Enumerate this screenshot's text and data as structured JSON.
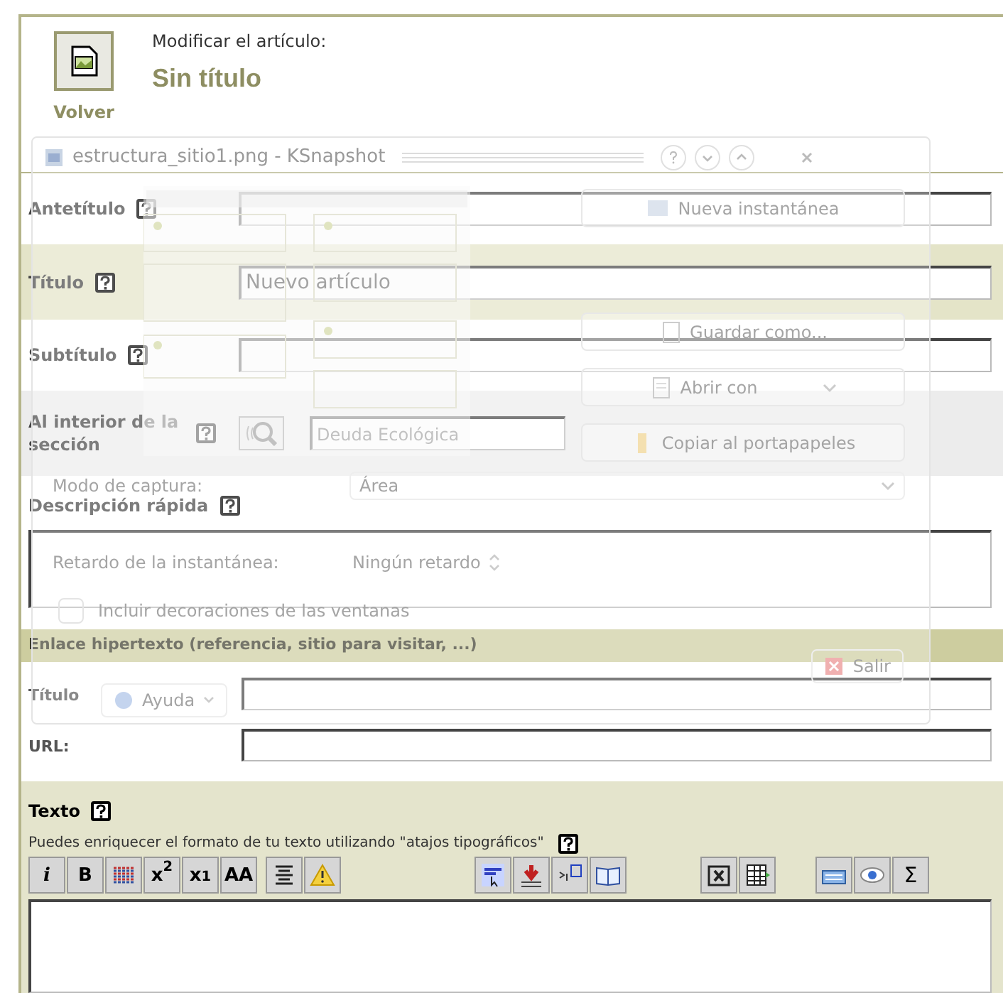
{
  "header": {
    "subtitle": "Modificar el artículo:",
    "title": "Sin título",
    "back": "Volver"
  },
  "fields": [
    {
      "kind": "input",
      "label": "Antetítulo",
      "help": true,
      "highlighted": false
    },
    {
      "kind": "input",
      "label": "Título",
      "help": true,
      "highlighted": true,
      "value": "Nuevo artículo"
    },
    {
      "kind": "input",
      "label": "Subtítulo",
      "help": true,
      "highlighted": false
    },
    {
      "kind": "section",
      "label": "Al interior de la sección",
      "help": true,
      "highlighted": false,
      "value": "Deuda Ecológica"
    },
    {
      "kind": "textarea",
      "label": "Descripción rápida",
      "help": true,
      "highlighted": false
    }
  ],
  "link": {
    "heading": "Enlace hipertexto (referencia, sitio para visitar, ...)",
    "fields": [
      {
        "label": "Título"
      },
      {
        "label": "URL:"
      }
    ]
  },
  "text": {
    "label": "Texto",
    "help": true,
    "hint": "Puedes enriquecer el formato de tu texto utilizando \"atajos tipográficos\"",
    "hint_help": true,
    "toolbar": [
      [
        {
          "kind": "italic",
          "text": "i"
        },
        {
          "kind": "bold",
          "text": "B"
        },
        {
          "kind": "strike"
        },
        {
          "kind": "sup",
          "text": "x$^{2}$"
        },
        {
          "kind": "sub",
          "text": "x$_{1}$"
        },
        {
          "kind": "caps",
          "text": "AA"
        },
        {
          "kind": "center"
        },
        {
          "kind": "warning"
        }
      ],
      [
        {
          "kind": "spip"
        },
        {
          "kind": "anchor"
        },
        {
          "kind": "note"
        },
        {
          "kind": "glossary"
        }
      ],
      [
        {
          "kind": "tools"
        },
        {
          "kind": "table"
        }
      ],
      [
        {
          "kind": "keyboard"
        },
        {
          "kind": "preview"
        },
        {
          "kind": "sigma",
          "text": "Σ"
        }
      ]
    ]
  },
  "ksnapshot": {
    "title": "estructura_sitio1.png - KSnapshot",
    "buttons": [
      {
        "kind": "new",
        "label": "Nueva instantánea"
      },
      {
        "kind": "save",
        "label": "Guardar como..."
      },
      {
        "kind": "open",
        "label": "Abrir con"
      },
      {
        "kind": "copy",
        "label": "Copiar al portapapeles"
      }
    ],
    "capture_mode": {
      "label": "Modo de captura:",
      "value": "Área"
    },
    "delay": {
      "label": "Retardo de la instantánea:",
      "value": "Ningún retardo"
    },
    "decorations": {
      "label": "Incluir decoraciones de las ventanas",
      "checked": false
    },
    "help_button": "Ayuda",
    "quit_button": "Salir"
  }
}
